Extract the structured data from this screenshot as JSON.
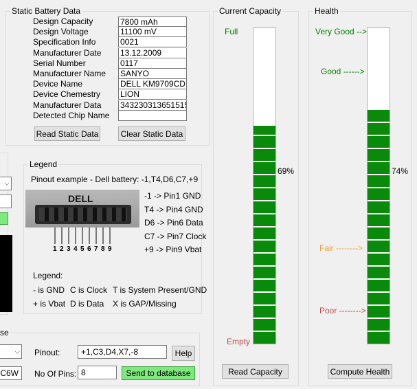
{
  "static_battery": {
    "title": "Static Battery Data",
    "fields": [
      {
        "label": "Design Capacity",
        "value": "7800 mAh"
      },
      {
        "label": "Design Voltage",
        "value": "11100 mV"
      },
      {
        "label": "Specification Info",
        "value": "0021"
      },
      {
        "label": "Manufacturer Date",
        "value": "13.12.2009"
      },
      {
        "label": "Serial Number",
        "value": "0117"
      },
      {
        "label": "Manufacturer Name",
        "value": "SANYO"
      },
      {
        "label": "Device Name",
        "value": "DELL KM9709CD"
      },
      {
        "label": "Device Chemestry",
        "value": "LION"
      },
      {
        "label": "Manufacturer Data",
        "value": "343230313651515"
      },
      {
        "label": "Detected Chip Name",
        "value": ""
      }
    ],
    "read_button": "Read Static Data",
    "clear_button": "Clear Static Data"
  },
  "legend": {
    "title": "Legend",
    "pinout_example": "Pinout example - Dell battery:  -1,T4,D6,C7,+9",
    "connector_brand": "DELL",
    "pin_numbers": [
      "1",
      "2",
      "3",
      "4",
      "5",
      "6",
      "7",
      "8",
      "9"
    ],
    "pin_map": [
      "-1 -> Pin1 GND",
      "T4 -> Pin4 GND",
      "D6 -> Pin6 Data",
      "C7 -> Pin7 Clock",
      "+9 -> Pin9 Vbat"
    ],
    "legend_label": "Legend:",
    "keys_row1": [
      "- is GND",
      "C is Clock",
      "T is System Present/GND"
    ],
    "keys_row2": [
      "+ is Vbat",
      "D is Data",
      "X is GAP/Missing"
    ]
  },
  "database": {
    "title_fragment": "se",
    "left_field_value": "C6W",
    "pinout_label": "Pinout:",
    "pinout_value": "+1,C3,D4,X7,-8",
    "help_button": "Help",
    "pins_label": "No Of Pins:",
    "pins_value": "8",
    "send_button": "Send to database"
  },
  "current_capacity": {
    "title": "Current Capacity",
    "full_label": "Full",
    "empty_label": "Empty",
    "percent": 69,
    "percent_text": "69%",
    "button": "Read Capacity",
    "colors": {
      "full": "#008000",
      "empty": "#c0504d",
      "fill": "#0a8a0a"
    }
  },
  "health": {
    "title": "Health",
    "levels": [
      "Very Good -->",
      "Good ------>",
      "Fair -------->",
      "Poor -------->"
    ],
    "level_colors": [
      "#008000",
      "#008000",
      "#e8a33a",
      "#c0504d"
    ],
    "percent": 74,
    "percent_text": "74%",
    "button": "Compute Health"
  }
}
